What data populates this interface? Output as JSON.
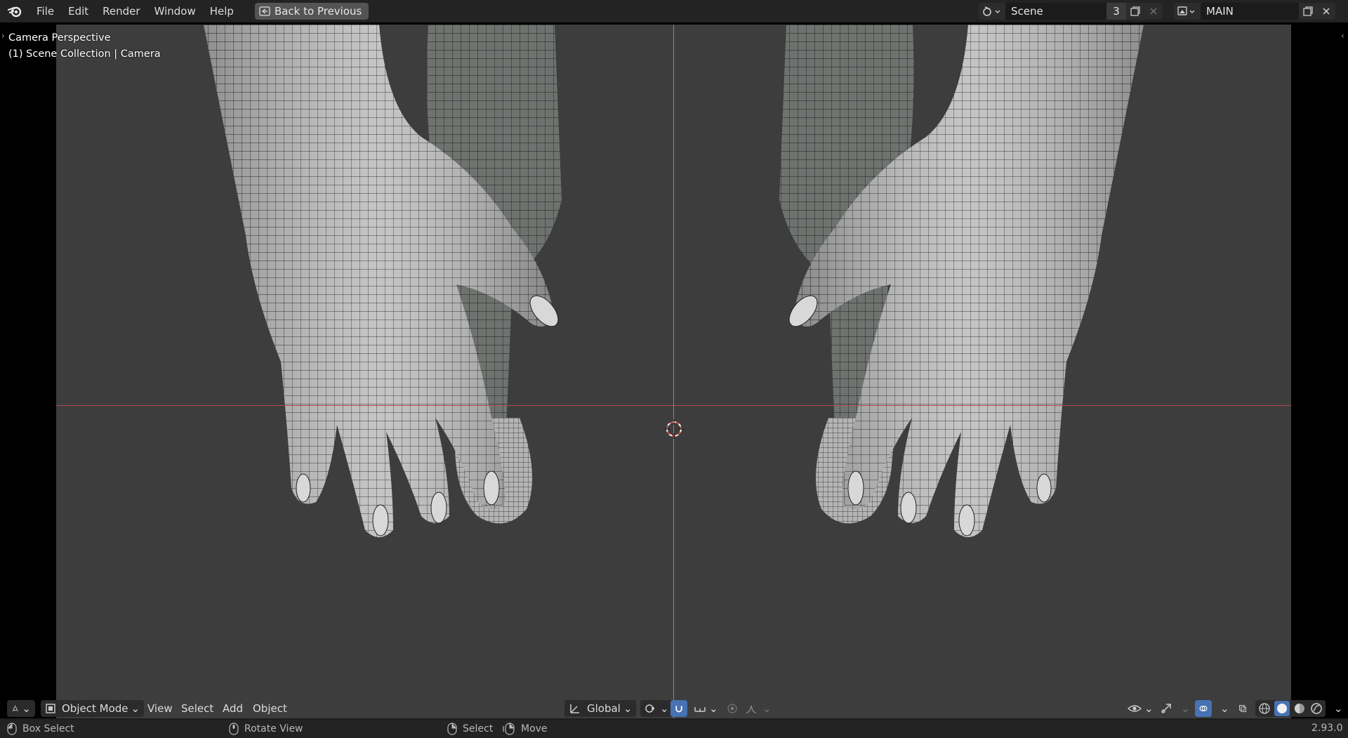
{
  "menu": {
    "file": "File",
    "edit": "Edit",
    "render": "Render",
    "window": "Window",
    "help": "Help",
    "back_to_previous": "Back to Previous"
  },
  "scene": {
    "name": "Scene",
    "users": "3",
    "view_layer": "MAIN"
  },
  "viewport": {
    "view_name": "Camera Perspective",
    "collection_info": "(1) Scene Collection | Camera"
  },
  "viewport_header": {
    "mode": "Object Mode",
    "view": "View",
    "select": "Select",
    "add": "Add",
    "object": "Object",
    "transform_orientation": "Global"
  },
  "statusbar": {
    "left_action": "Box Select",
    "middle_action": "Rotate View",
    "right_select": "Select",
    "right_move": "Move",
    "version": "2.93.0"
  },
  "colors": {
    "accent": "#4772b3",
    "x_axis": "#b34a4f",
    "y_axis": "#7ba23c",
    "viewport_bg": "#3d3d3d"
  }
}
